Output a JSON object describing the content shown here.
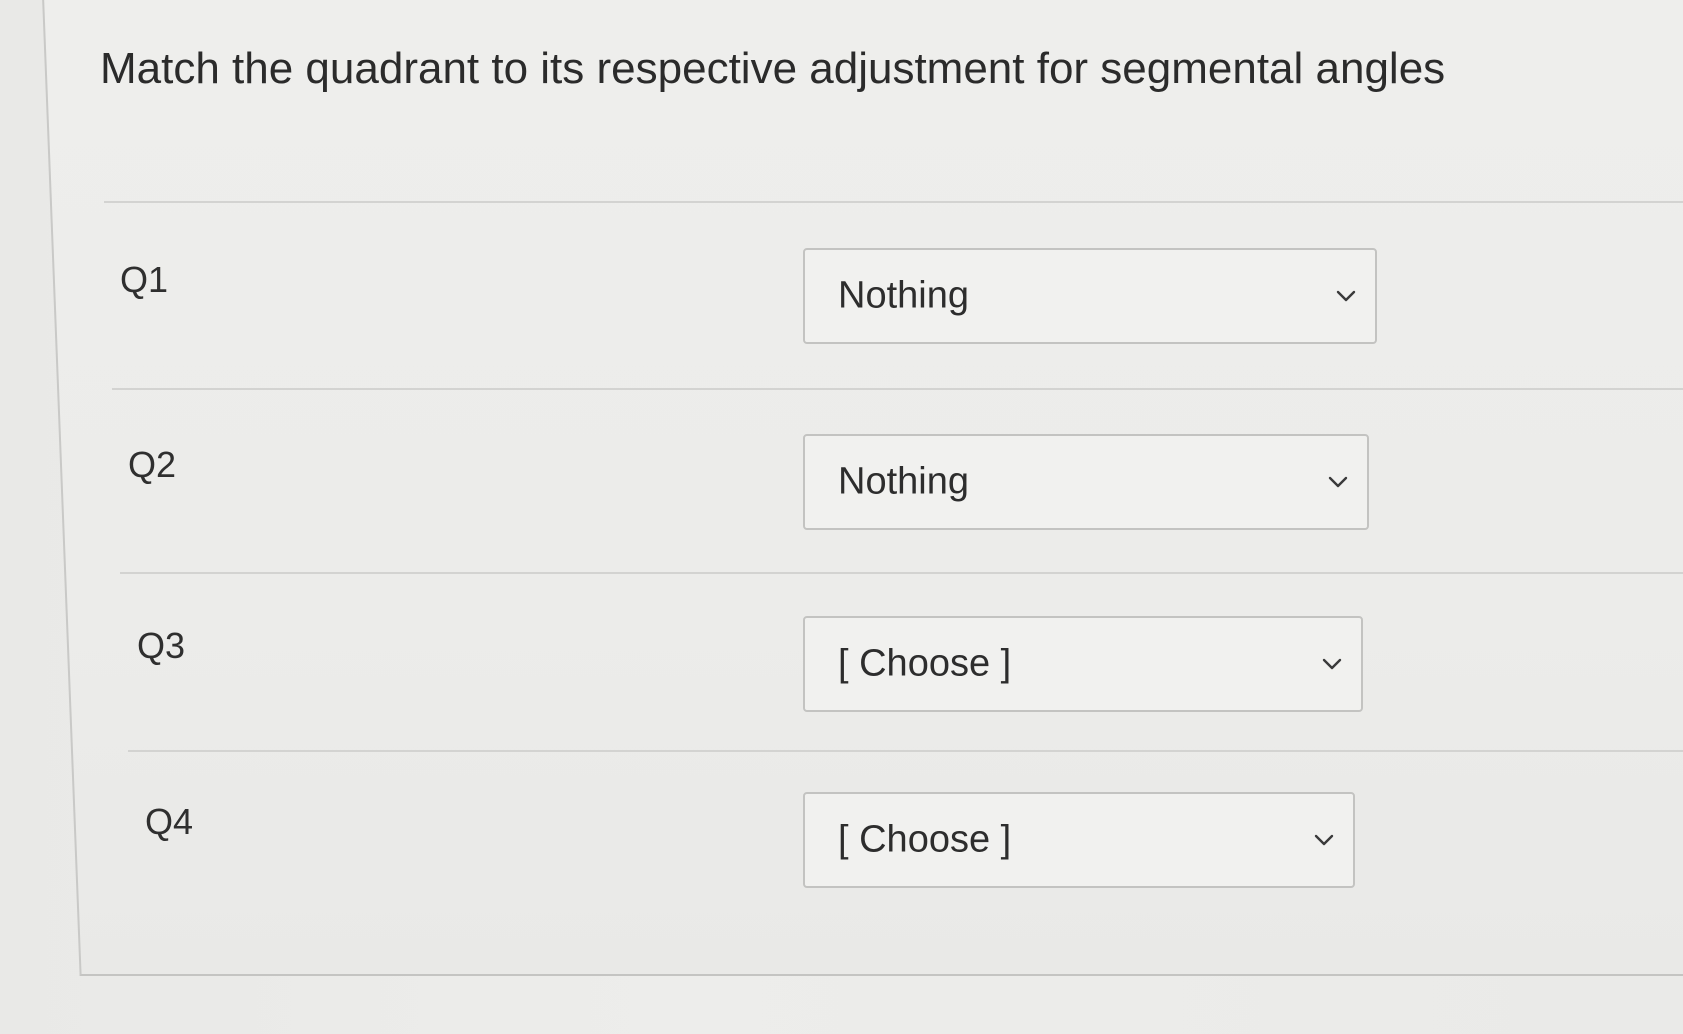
{
  "question": {
    "title": "Match the quadrant to its respective adjustment for segmental angles"
  },
  "rows": [
    {
      "label": "Q1",
      "selected": "Nothing"
    },
    {
      "label": "Q2",
      "selected": "Nothing"
    },
    {
      "label": "Q3",
      "selected": "[ Choose ]"
    },
    {
      "label": "Q4",
      "selected": "[ Choose ]"
    }
  ],
  "icons": {
    "dropdown": "chevron-down-icon"
  },
  "colors": {
    "background": "#ecece9",
    "text": "#2b2b2b",
    "select_border": "#c3c3c1",
    "divider": "#d3d3d1"
  }
}
